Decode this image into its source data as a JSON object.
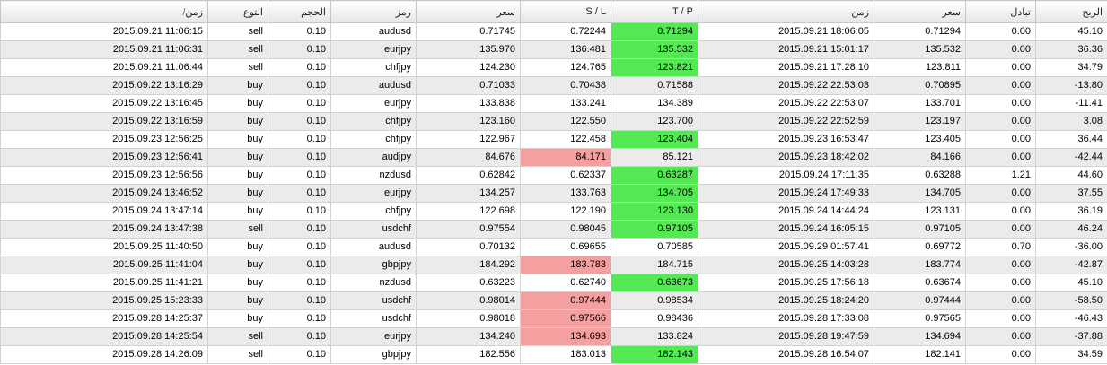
{
  "colors": {
    "green_highlight": "#54e854",
    "red_highlight": "#f4a0a0",
    "alt_row": "#ebebeb",
    "grid": "#d2d2d2"
  },
  "columns": [
    {
      "key": "open_time",
      "label": "زمن",
      "sort_mark": "/"
    },
    {
      "key": "type",
      "label": "التوع"
    },
    {
      "key": "volume",
      "label": "الحجم"
    },
    {
      "key": "symbol",
      "label": "رمز"
    },
    {
      "key": "open_price",
      "label": "سعر"
    },
    {
      "key": "sl",
      "label": "S / L"
    },
    {
      "key": "tp",
      "label": "T / P"
    },
    {
      "key": "close_time",
      "label": "زمن"
    },
    {
      "key": "close_price",
      "label": "سعر"
    },
    {
      "key": "swap",
      "label": "تبادل"
    },
    {
      "key": "profit",
      "label": "الربح"
    }
  ],
  "rows": [
    {
      "open_time": "2015.09.21 11:06:15",
      "type": "sell",
      "volume": "0.10",
      "symbol": "audusd",
      "open_price": "0.71745",
      "sl": "0.72244",
      "tp": "0.71294",
      "close_time": "2015.09.21 18:06:05",
      "close_price": "0.71294",
      "swap": "0.00",
      "profit": "45.10",
      "hl": "tp"
    },
    {
      "open_time": "2015.09.21 11:06:31",
      "type": "sell",
      "volume": "0.10",
      "symbol": "eurjpy",
      "open_price": "135.970",
      "sl": "136.481",
      "tp": "135.532",
      "close_time": "2015.09.21 15:01:17",
      "close_price": "135.532",
      "swap": "0.00",
      "profit": "36.36",
      "hl": "tp"
    },
    {
      "open_time": "2015.09.21 11:06:44",
      "type": "sell",
      "volume": "0.10",
      "symbol": "chfjpy",
      "open_price": "124.230",
      "sl": "124.765",
      "tp": "123.821",
      "close_time": "2015.09.21 17:28:10",
      "close_price": "123.811",
      "swap": "0.00",
      "profit": "34.79",
      "hl": "tp"
    },
    {
      "open_time": "2015.09.22 13:16:29",
      "type": "buy",
      "volume": "0.10",
      "symbol": "audusd",
      "open_price": "0.71033",
      "sl": "0.70438",
      "tp": "0.71588",
      "close_time": "2015.09.22 22:53:03",
      "close_price": "0.70895",
      "swap": "0.00",
      "profit": "-13.80",
      "hl": ""
    },
    {
      "open_time": "2015.09.22 13:16:45",
      "type": "buy",
      "volume": "0.10",
      "symbol": "eurjpy",
      "open_price": "133.838",
      "sl": "133.241",
      "tp": "134.389",
      "close_time": "2015.09.22 22:53:07",
      "close_price": "133.701",
      "swap": "0.00",
      "profit": "-11.41",
      "hl": ""
    },
    {
      "open_time": "2015.09.22 13:16:59",
      "type": "buy",
      "volume": "0.10",
      "symbol": "chfjpy",
      "open_price": "123.160",
      "sl": "122.550",
      "tp": "123.700",
      "close_time": "2015.09.22 22:52:59",
      "close_price": "123.197",
      "swap": "0.00",
      "profit": "3.08",
      "hl": ""
    },
    {
      "open_time": "2015.09.23 12:56:25",
      "type": "buy",
      "volume": "0.10",
      "symbol": "chfjpy",
      "open_price": "122.967",
      "sl": "122.458",
      "tp": "123.404",
      "close_time": "2015.09.23 16:53:47",
      "close_price": "123.405",
      "swap": "0.00",
      "profit": "36.44",
      "hl": "tp"
    },
    {
      "open_time": "2015.09.23 12:56:41",
      "type": "buy",
      "volume": "0.10",
      "symbol": "audjpy",
      "open_price": "84.676",
      "sl": "84.171",
      "tp": "85.121",
      "close_time": "2015.09.23 18:42:02",
      "close_price": "84.166",
      "swap": "0.00",
      "profit": "-42.44",
      "hl": "sl"
    },
    {
      "open_time": "2015.09.23 12:56:56",
      "type": "buy",
      "volume": "0.10",
      "symbol": "nzdusd",
      "open_price": "0.62842",
      "sl": "0.62337",
      "tp": "0.63287",
      "close_time": "2015.09.24 17:11:35",
      "close_price": "0.63288",
      "swap": "1.21",
      "profit": "44.60",
      "hl": "tp"
    },
    {
      "open_time": "2015.09.24 13:46:52",
      "type": "buy",
      "volume": "0.10",
      "symbol": "eurjpy",
      "open_price": "134.257",
      "sl": "133.763",
      "tp": "134.705",
      "close_time": "2015.09.24 17:49:33",
      "close_price": "134.705",
      "swap": "0.00",
      "profit": "37.55",
      "hl": "tp"
    },
    {
      "open_time": "2015.09.24 13:47:14",
      "type": "buy",
      "volume": "0.10",
      "symbol": "chfjpy",
      "open_price": "122.698",
      "sl": "122.190",
      "tp": "123.130",
      "close_time": "2015.09.24 14:44:24",
      "close_price": "123.131",
      "swap": "0.00",
      "profit": "36.19",
      "hl": "tp"
    },
    {
      "open_time": "2015.09.24 13:47:38",
      "type": "sell",
      "volume": "0.10",
      "symbol": "usdchf",
      "open_price": "0.97554",
      "sl": "0.98045",
      "tp": "0.97105",
      "close_time": "2015.09.24 16:05:15",
      "close_price": "0.97105",
      "swap": "0.00",
      "profit": "46.24",
      "hl": "tp"
    },
    {
      "open_time": "2015.09.25 11:40:50",
      "type": "buy",
      "volume": "0.10",
      "symbol": "audusd",
      "open_price": "0.70132",
      "sl": "0.69655",
      "tp": "0.70585",
      "close_time": "2015.09.29 01:57:41",
      "close_price": "0.69772",
      "swap": "0.70",
      "profit": "-36.00",
      "hl": ""
    },
    {
      "open_time": "2015.09.25 11:41:04",
      "type": "buy",
      "volume": "0.10",
      "symbol": "gbpjpy",
      "open_price": "184.292",
      "sl": "183.783",
      "tp": "184.715",
      "close_time": "2015.09.25 14:03:28",
      "close_price": "183.774",
      "swap": "0.00",
      "profit": "-42.87",
      "hl": "sl"
    },
    {
      "open_time": "2015.09.25 11:41:21",
      "type": "buy",
      "volume": "0.10",
      "symbol": "nzdusd",
      "open_price": "0.63223",
      "sl": "0.62740",
      "tp": "0.63673",
      "close_time": "2015.09.25 17:56:18",
      "close_price": "0.63674",
      "swap": "0.00",
      "profit": "45.10",
      "hl": "tp"
    },
    {
      "open_time": "2015.09.25 15:23:33",
      "type": "buy",
      "volume": "0.10",
      "symbol": "usdchf",
      "open_price": "0.98014",
      "sl": "0.97444",
      "tp": "0.98534",
      "close_time": "2015.09.25 18:24:20",
      "close_price": "0.97444",
      "swap": "0.00",
      "profit": "-58.50",
      "hl": "sl"
    },
    {
      "open_time": "2015.09.28 14:25:37",
      "type": "buy",
      "volume": "0.10",
      "symbol": "usdchf",
      "open_price": "0.98018",
      "sl": "0.97566",
      "tp": "0.98436",
      "close_time": "2015.09.28 17:33:08",
      "close_price": "0.97565",
      "swap": "0.00",
      "profit": "-46.43",
      "hl": "sl"
    },
    {
      "open_time": "2015.09.28 14:25:54",
      "type": "sell",
      "volume": "0.10",
      "symbol": "eurjpy",
      "open_price": "134.240",
      "sl": "134.693",
      "tp": "133.824",
      "close_time": "2015.09.28 19:47:59",
      "close_price": "134.694",
      "swap": "0.00",
      "profit": "-37.88",
      "hl": "sl"
    },
    {
      "open_time": "2015.09.28 14:26:09",
      "type": "sell",
      "volume": "0.10",
      "symbol": "gbpjpy",
      "open_price": "182.556",
      "sl": "183.013",
      "tp": "182.143",
      "close_time": "2015.09.28 16:54:07",
      "close_price": "182.141",
      "swap": "0.00",
      "profit": "34.59",
      "hl": "tp"
    }
  ]
}
